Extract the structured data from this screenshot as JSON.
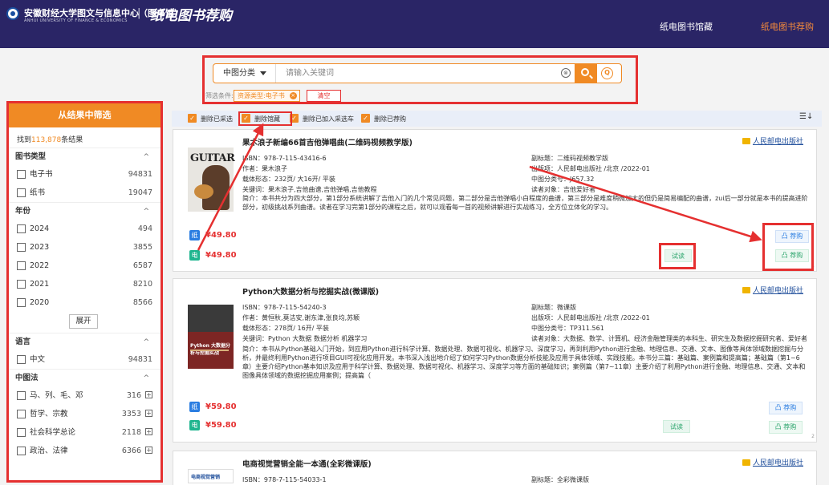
{
  "header": {
    "logo_text": "安徽财经大学图文与信息中心（图书馆）",
    "logo_subtext": "ANHUI UNIVERSITY OF FINANCE & ECONOMICS",
    "separator": "|",
    "site_title": "纸电图书荐购",
    "nav": [
      "纸电图书馆藏",
      "纸电图书荐购"
    ],
    "accent_color": "#f58a3a",
    "bg_color": "#2a2566"
  },
  "search": {
    "category": "中图分类",
    "placeholder": "请输入关键词",
    "clear_glyph": "⊗",
    "adv_glyph": "Q",
    "filter_label": "筛选条件:",
    "filter_tag": "资源类型:电子书",
    "filter_tag_x": "×",
    "clear_label": "清空"
  },
  "sidebar": {
    "title": "从结果中筛选",
    "count_prefix": "找到",
    "count_value": "113,878",
    "count_suffix": "条结果",
    "caret": "^",
    "expand_label": "展开",
    "plus_glyph": "+",
    "sections": {
      "type": {
        "title": "图书类型",
        "items": [
          {
            "label": "电子书",
            "count": "94831"
          },
          {
            "label": "纸书",
            "count": "19047"
          }
        ]
      },
      "year": {
        "title": "年份",
        "items": [
          {
            "label": "2024",
            "count": "494"
          },
          {
            "label": "2023",
            "count": "3855"
          },
          {
            "label": "2022",
            "count": "6587"
          },
          {
            "label": "2021",
            "count": "8210"
          },
          {
            "label": "2020",
            "count": "8566"
          }
        ]
      },
      "lang": {
        "title": "语言",
        "items": [
          {
            "label": "中文",
            "count": "94831"
          }
        ]
      },
      "clc": {
        "title": "中图法",
        "items": [
          {
            "label": "马、列、毛、邓",
            "count": "316"
          },
          {
            "label": "哲学、宗教",
            "count": "3353"
          },
          {
            "label": "社会科学总论",
            "count": "2118"
          },
          {
            "label": "政治、法律",
            "count": "6366"
          }
        ]
      }
    }
  },
  "toolbar": {
    "check_glyph": "✓",
    "options": [
      "删除已采选",
      "删除馆藏",
      "删除已加入采选车",
      "删除已荐购"
    ],
    "sort_glyph": "☰↓"
  },
  "books": [
    {
      "title": "果木浪子新编66首吉他弹唱曲(二维码视频教学版)",
      "cover_text": "GUITAR",
      "isbn": "ISBN：978-7-115-43416-6",
      "author": "作者：果木浪子",
      "format": "载体形态：232页/ 大16开/ 平装",
      "keywords": "关键词：果木浪子,吉他曲谱,吉他弹唱,吉他教程",
      "subtitle": "副标题：二维码视频教学版",
      "publish": "出版项：人民邮电出版社 /北京 /2022-01",
      "clc": "中图分类号：J657.32",
      "audience": "读者对象：吉他爱好者",
      "summary": "简介：本书共分为四大部分，第1部分系统讲解了吉他入门的几个常见问题，第二部分是吉他弹唱小白程度的曲谱，第三部分是难度稍微加大的但仍是简易编配的曲谱，zui后一部分就是本书的提高进阶部分，初级挑战系列曲谱。读者在学习完第1部分的课程之后，就可以观看每一首的视频讲解进行实战练习，全方位立体化的学习。",
      "publisher": "人民邮电出版社",
      "paper_badge": "纸",
      "e_badge": "电",
      "paper_price": "¥49.80",
      "e_price": "¥49.80",
      "try_label": "试读",
      "rec_label": "凸 荐购",
      "page_num": "1"
    },
    {
      "title": "Python大数据分析与挖掘实战(微课版)",
      "cover_text": "Python 大数据分析与挖掘实战",
      "isbn": "ISBN：978-7-115-54240-3",
      "author": "作者：黄恒秋,莫洁安,谢东津,张良均,苏颖",
      "format": "载体形态：278页/ 16开/ 平装",
      "keywords": "关键词：Python 大数据 数据分析 机器学习",
      "subtitle": "副标题：微课版",
      "publish": "出版项：人民邮电出版社 /北京 /2022-01",
      "clc": "中图分类号：TP311.561",
      "audience": "读者对象：大数据、数学、计算机、经济金融管理类的本科生、研究生及数据挖掘研究者、爱好者",
      "summary": "简介：本书从Python基础入门开始，到应用Python进行科学计算、数据处理、数据可视化、机器学习、深度学习，再到利用Python进行金融、地理信息、交通、文本、图像等具体领域数据挖掘与分析，并最终利用Python进行项目GUI可视化应用开发。本书深入浅出地介绍了如何学习Python数据分析技能及应用于具体领域、实践技能。本书分三篇：基础篇、案例篇和提高篇；基础篇（第1~6章）主要介绍Python基本知识及应用于科学计算、数据处理、数据可视化、机器学习、深度学习等方面的基础知识；案例篇（第7~11章）主要介绍了利用Python进行金融、地理信息、交通、文本和图像具体领域的数据挖掘应用案例；提高篇（",
      "publisher": "人民邮电出版社",
      "paper_badge": "纸",
      "e_badge": "电",
      "paper_price": "¥59.80",
      "e_price": "¥59.80",
      "try_label": "试读",
      "rec_label": "凸 荐购",
      "page_num": "2"
    },
    {
      "title": "电商视觉营销全能一本通(全彩微课版)",
      "cover_text": "电商视觉营销",
      "isbn": "ISBN：978-7-115-54033-1",
      "subtitle": "副标题：全彩微课版",
      "publisher": "人民邮电出版社"
    }
  ]
}
